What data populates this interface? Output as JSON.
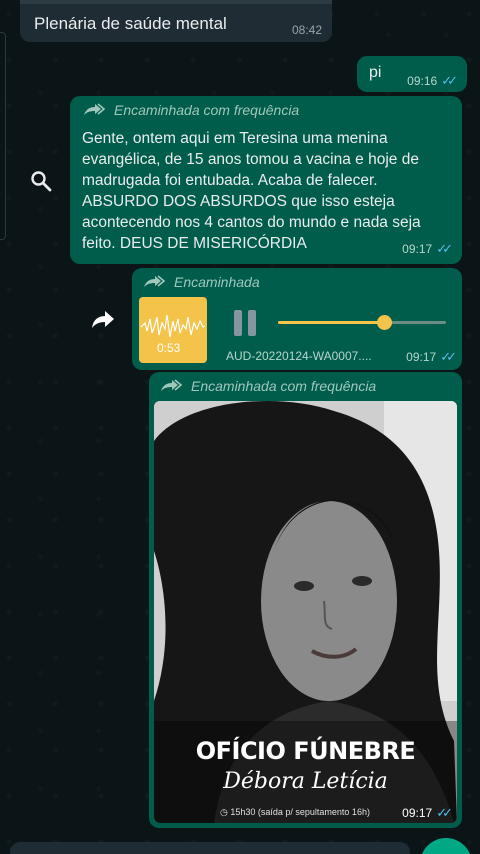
{
  "reply_preview": {
    "text": "Plenária de saúde mental",
    "time": "08:42"
  },
  "messages": {
    "pi": {
      "text": "pi",
      "time": "09:16"
    },
    "text_message": {
      "forward_label": "Encaminhada com frequência",
      "body": "Gente, ontem aqui em Teresina uma menina evangélica, de 15 anos tomou a vacina e hoje de madrugada foi entubada. Acaba de falecer. ABSURDO DOS ABSURDOS que isso esteja acontecendo nos 4 cantos do mundo e nada seja feito. DEUS DE MISERICÓRDIA",
      "time": "09:17"
    },
    "audio": {
      "forward_label": "Encaminhada",
      "duration": "0:53",
      "filename": "AUD-20220124-WA0007....",
      "time": "09:17",
      "progress": 0.63
    },
    "image": {
      "forward_label": "Encaminhada com frequência",
      "title": "OFÍCIO FÚNEBRE",
      "name": "Débora Letícia",
      "info": "◷ 15h30 (saída p/ sepultamento 16h)",
      "time": "09:17"
    }
  },
  "icons": {
    "search": "search-icon",
    "forward": "forward-icon",
    "pause": "pause-icon",
    "read": "double-check-icon"
  },
  "colors": {
    "bubble_out": "#005c4b",
    "audio_accent": "#f3c34a",
    "read_ticks": "#53bdeb"
  }
}
